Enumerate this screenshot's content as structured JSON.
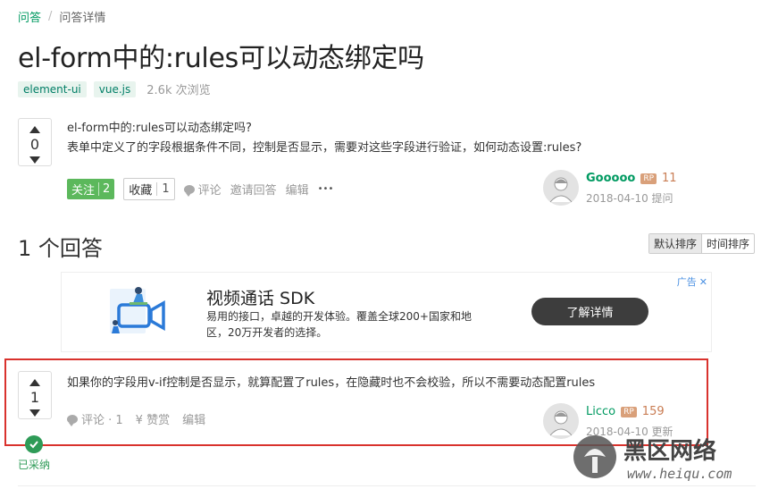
{
  "breadcrumb": {
    "root": "问答",
    "separator": "/",
    "current": "问答详情"
  },
  "question": {
    "title": "el-form中的:rules可以动态绑定吗",
    "tags": [
      "element-ui",
      "vue.js"
    ],
    "views": "2.6k 次浏览",
    "votes": "0",
    "body_line1": "el-form中的:rules可以动态绑定吗?",
    "body_line2": "表单中定义了的字段根据条件不同，控制是否显示，需要对这些字段进行验证，如何动态设置:rules?",
    "follow_label": "关注",
    "follow_count": "2",
    "collect_label": "收藏",
    "collect_count": "1",
    "comment_label": "评论",
    "invite_label": "邀请回答",
    "edit_label": "编辑",
    "more_label": "•••",
    "author": {
      "name": "Gooooo",
      "rp": "RP",
      "reputation": "11",
      "date": "2018-04-10 提问"
    }
  },
  "answers": {
    "title": "1 个回答",
    "sort_default": "默认排序",
    "sort_time": "时间排序"
  },
  "ad": {
    "title": "视频通话 SDK",
    "desc": "易用的接口，卓越的开发体验。覆盖全球200+国家和地区，20万开发者的选择。",
    "button": "了解详情",
    "label": "广告",
    "close": "✕"
  },
  "answer": {
    "votes": "1",
    "body": "如果你的字段用v-if控制是否显示，就算配置了rules，在隐藏时也不会校验，所以不需要动态配置rules",
    "comment_label": "评论 · 1",
    "reward_label": "¥ 赞赏",
    "edit_label": "编辑",
    "accepted_label": "已采纳",
    "author": {
      "name": "Licco",
      "rp": "RP",
      "reputation": "159",
      "date": "2018-04-10 更新"
    }
  },
  "watermark": {
    "brand": "黑区网络",
    "url": "www.heiqu.com"
  },
  "colors": {
    "brand_green": "#009a61",
    "follow_green": "#5cb85c",
    "highlight_red": "#d9322d",
    "accepted_green": "#2e9b57"
  }
}
